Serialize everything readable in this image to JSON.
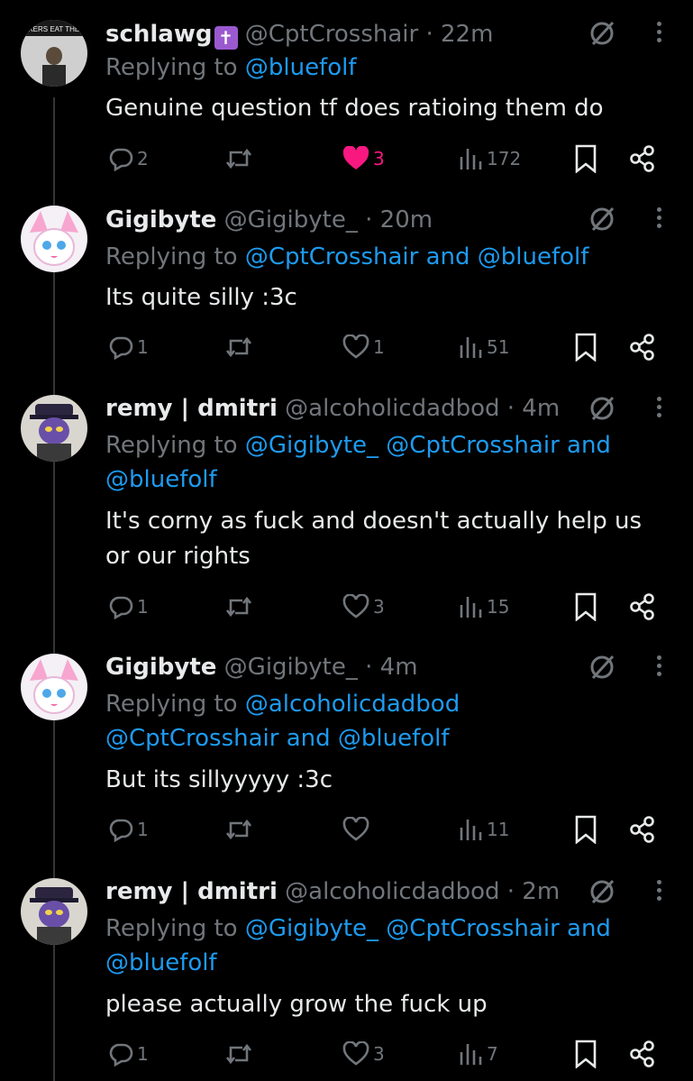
{
  "tweets": [
    {
      "name": "schlawg",
      "badge": "✝",
      "handle": "@CptCrosshair",
      "time": "· 22m",
      "reply_prefix": "Replying to ",
      "reply_lines": [
        "@bluefolf"
      ],
      "text_lines": [
        "Genuine question tf does ratioing them do"
      ],
      "replies": "2",
      "retweets": "",
      "likes": "3",
      "liked": true,
      "views": "172",
      "avatar": "dark-photo"
    },
    {
      "name": "Gigibyte",
      "handle": "@Gigibyte_",
      "time": "· 20m",
      "reply_prefix": "Replying to ",
      "reply_lines": [
        "@CptCrosshair and @bluefolf"
      ],
      "text_lines": [
        "Its quite silly :3c"
      ],
      "replies": "1",
      "retweets": "",
      "likes": "1",
      "liked": false,
      "views": "51",
      "avatar": "pink-creature"
    },
    {
      "name": "remy | dmitri",
      "handle": "@alcoholicdadbod",
      "time": "· 4m",
      "reply_prefix": "Replying to ",
      "reply_lines": [
        "@Gigibyte_ @CptCrosshair and",
        "@bluefolf"
      ],
      "text_lines": [
        "It's corny as fuck and doesn't actually help us",
        "or our rights"
      ],
      "replies": "1",
      "retweets": "",
      "likes": "3",
      "liked": false,
      "views": "15",
      "avatar": "purple-character"
    },
    {
      "name": "Gigibyte",
      "handle": "@Gigibyte_",
      "time": "· 4m",
      "reply_prefix": "Replying to ",
      "reply_lines": [
        "@alcoholicdadbod",
        "@CptCrosshair and @bluefolf"
      ],
      "text_lines": [
        "But its sillyyyyy :3c"
      ],
      "replies": "1",
      "retweets": "",
      "likes": "",
      "liked": false,
      "views": "11",
      "avatar": "pink-creature"
    },
    {
      "name": "remy | dmitri",
      "handle": "@alcoholicdadbod",
      "time": "· 2m",
      "reply_prefix": "Replying to ",
      "reply_lines": [
        "@Gigibyte_ @CptCrosshair and",
        "@bluefolf"
      ],
      "text_lines": [
        "please actually grow the fuck up"
      ],
      "replies": "1",
      "retweets": "",
      "likes": "3",
      "liked": false,
      "views": "7",
      "avatar": "purple-character"
    }
  ],
  "icons": {
    "reply": "reply-icon",
    "retweet": "retweet-icon",
    "like": "heart-icon",
    "views": "views-icon",
    "bookmark": "bookmark-icon",
    "share": "share-icon",
    "grok": "grok-icon",
    "more": "more-icon"
  },
  "colors": {
    "background": "#000000",
    "text": "#e7e9ea",
    "muted": "#71767b",
    "link": "#1d9bf0",
    "like": "#f91880",
    "badge": "#9b59d0"
  }
}
